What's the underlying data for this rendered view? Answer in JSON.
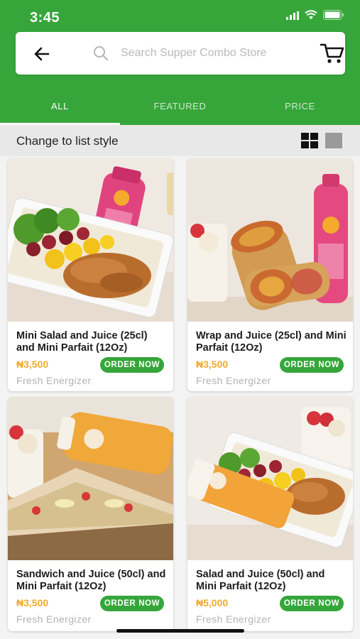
{
  "status_bar": {
    "time": "3:45"
  },
  "search": {
    "placeholder": "Search Supper Combo Store"
  },
  "tabs": [
    {
      "label": "ALL",
      "active": true
    },
    {
      "label": "FEATURED",
      "active": false
    },
    {
      "label": "PRICE",
      "active": false
    }
  ],
  "list_style": {
    "label": "Change to list style"
  },
  "products": [
    {
      "title": "Mini Salad and Juice (25cl) and Mini Parfait (12Oz)",
      "price": "₦3,500",
      "button": "ORDER NOW",
      "vendor": "Fresh Energizer"
    },
    {
      "title": "Wrap and Juice (25cl) and Mini Parfait (12Oz)",
      "price": "₦3,500",
      "button": "ORDER NOW",
      "vendor": "Fresh Energizer"
    },
    {
      "title": "Sandwich and Juice (50cl) and Mini Parfait (12Oz)",
      "price": "₦3,500",
      "button": "ORDER NOW",
      "vendor": "Fresh Energizer"
    },
    {
      "title": "Salad and Juice (50cl) and Mini Parfait (12Oz)",
      "price": "₦5,000",
      "button": "ORDER NOW",
      "vendor": "Fresh Energizer"
    }
  ],
  "colors": {
    "brand_green": "#36a63b",
    "price_orange": "#f2ab2d",
    "vendor_gray": "#b3b3b3"
  },
  "icons": [
    "back-arrow-icon",
    "search-icon",
    "cart-icon",
    "grid-view-icon",
    "list-view-icon",
    "wifi-icon",
    "battery-icon",
    "signal-icon"
  ]
}
